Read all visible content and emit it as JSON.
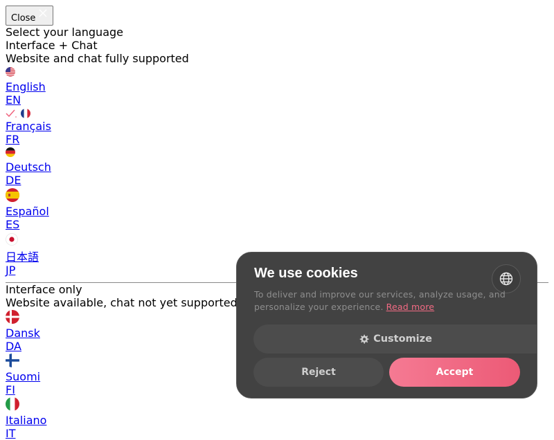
{
  "close_button": {
    "label": "Close"
  },
  "modal": {
    "title": "Select your language",
    "groups": [
      {
        "title": "Interface + Chat",
        "subtitle": "Website and chat fully supported",
        "languages": [
          {
            "name": "English",
            "code": "EN",
            "flag": "us-flag"
          },
          {
            "name": "Français",
            "code": "FR",
            "flag": "fr-flag",
            "selected": true
          },
          {
            "name": "Deutsch",
            "code": "DE",
            "flag": "de-flag"
          },
          {
            "name": "Español",
            "code": "ES",
            "flag": "es-flag"
          },
          {
            "name": "日本語",
            "code": "JP",
            "flag": "jp-flag"
          }
        ]
      },
      {
        "title": "Interface only",
        "subtitle": "Website available, chat not yet supported",
        "languages": [
          {
            "name": "Dansk",
            "code": "DA",
            "flag": "dk-flag"
          },
          {
            "name": "Suomi",
            "code": "FI",
            "flag": "fi-flag"
          },
          {
            "name": "Italiano",
            "code": "IT",
            "flag": "it-flag"
          }
        ]
      }
    ]
  },
  "cookie_banner": {
    "title": "We use cookies",
    "description": "To deliver and improve our services, analyze usage, and personalize your experience.",
    "read_more": "Read more",
    "customize_label": "Customize",
    "reject_label": "Reject",
    "accept_label": "Accept",
    "accent_color": "#f0647f",
    "background_color": "#424242"
  }
}
